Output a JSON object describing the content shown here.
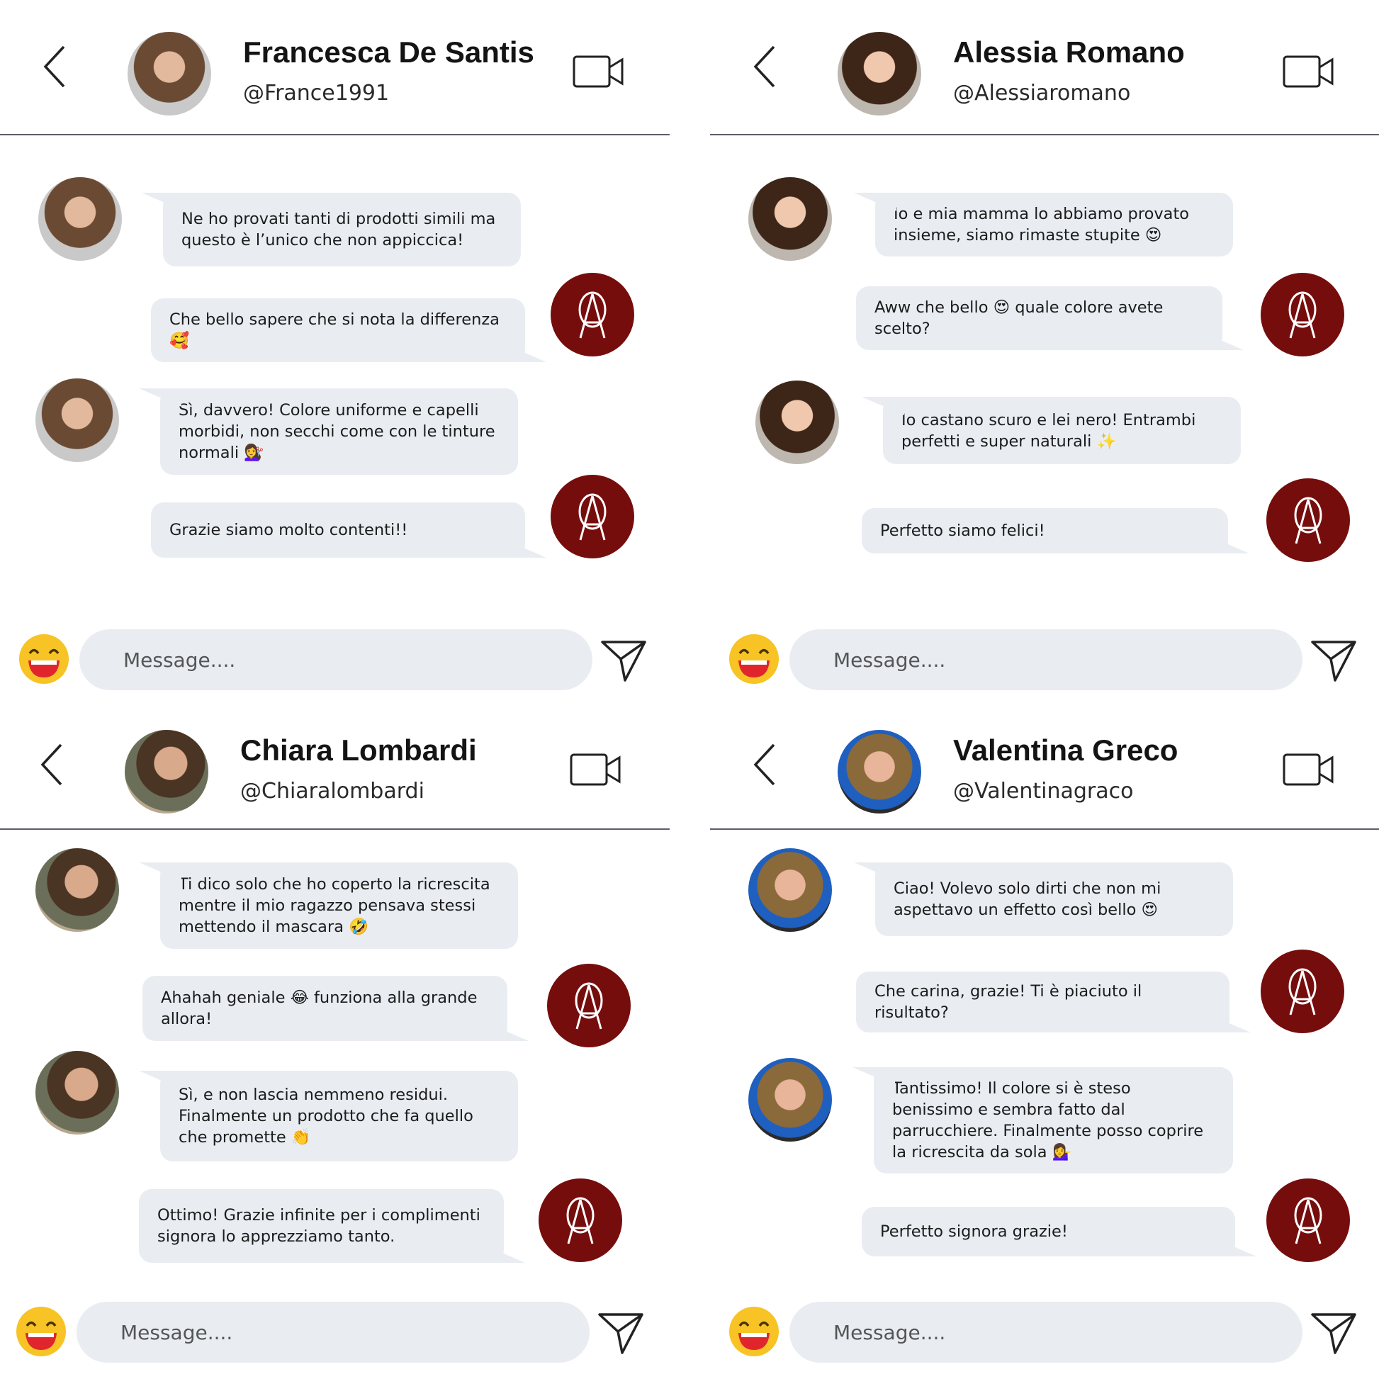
{
  "colors": {
    "bubble": "#e9edf2",
    "brand": "#760d0d",
    "divider": "#5d5d6a"
  },
  "icons": {
    "back": "chevron-left-icon",
    "video": "video-camera-icon",
    "send": "send-icon",
    "emoji": "smiley-emoji-icon"
  },
  "composer_placeholder": "Message....",
  "chats": [
    {
      "name": "Francesca De Santis",
      "handle": "@France1991",
      "messages": [
        {
          "from": "customer",
          "text": "Ne ho provati tanti di prodotti simili ma\nquesto è l’unico che non appiccica!"
        },
        {
          "from": "brand",
          "text": "Che bello sapere che si nota la differenza\n🥰"
        },
        {
          "from": "customer",
          "text": "Sì, davvero! Colore uniforme e capelli\nmorbidi, non secchi come con le tinture\nnormali 💇‍♀️"
        },
        {
          "from": "brand",
          "text": "Grazie siamo molto contenti!!"
        }
      ]
    },
    {
      "name": "Alessia Romano",
      "handle": "@Alessiaromano",
      "messages": [
        {
          "from": "customer",
          "text": "Io e mia mamma lo abbiamo provato\ninsieme, siamo rimaste stupite 😍"
        },
        {
          "from": "brand",
          "text": "Aww che bello 😍 quale colore avete\nscelto?"
        },
        {
          "from": "customer",
          "text": "Io castano scuro e lei nero! Entrambi\nperfetti e super naturali ✨"
        },
        {
          "from": "brand",
          "text": "Perfetto siamo felici!"
        }
      ]
    },
    {
      "name": "Chiara Lombardi",
      "handle": "@Chiaralombardi",
      "messages": [
        {
          "from": "customer",
          "text": "Ti dico solo che ho coperto la ricrescita\nmentre il mio ragazzo pensava stessi\nmettendo il mascara 🤣"
        },
        {
          "from": "brand",
          "text": "Ahahah geniale 😂 funziona alla grande\nallora!"
        },
        {
          "from": "customer",
          "text": "Sì, e non lascia nemmeno residui.\nFinalmente un prodotto che fa quello\nche promette 👏"
        },
        {
          "from": "brand",
          "text": "Ottimo! Grazie infinite per i complimenti\nsignora lo apprezziamo tanto."
        }
      ]
    },
    {
      "name": "Valentina Greco",
      "handle": "@Valentinagraco",
      "messages": [
        {
          "from": "customer",
          "text": "Ciao! Volevo solo dirti che non mi\naspettavo un effetto così bello 😍"
        },
        {
          "from": "brand",
          "text": "Che carina, grazie! Ti è piaciuto il\nrisultato?"
        },
        {
          "from": "customer",
          "text": "Tantissimo! Il colore si è steso\nbenissimo e sembra fatto dal\nparrucchiere. Finalmente posso coprire\nla ricrescita da sola 💁‍♀️"
        },
        {
          "from": "brand",
          "text": "Perfetto signora grazie!"
        }
      ]
    }
  ]
}
